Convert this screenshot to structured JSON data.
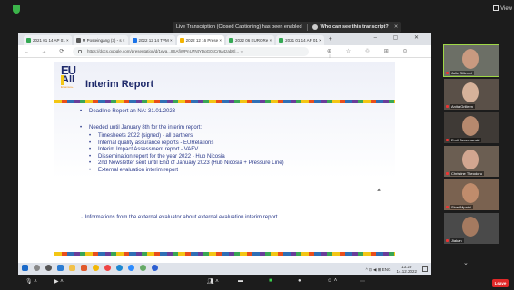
{
  "zoom": {
    "view_label": "View",
    "notice_text": "Live Transcription (Closed Captioning) has been enabled",
    "notice_question": "Who can see this transcript?",
    "leave_label": "Leave"
  },
  "browser": {
    "tabs": [
      {
        "label": "2021 01 14 AP 01 ×",
        "color": "#34a853"
      },
      {
        "label": "M Posteingang (3) - s ×",
        "color": "#555555"
      },
      {
        "label": "2022 12 14 TPM ×",
        "color": "#1a73e8"
      },
      {
        "label": "2022 12 16 Prese ×",
        "color": "#f4b400",
        "active": true
      },
      {
        "label": "2022 06 EURORe ×",
        "color": "#34a853"
      },
      {
        "label": "2021 01 14 AP 01 ×",
        "color": "#34a853"
      }
    ],
    "url": "https://docs.google.com/presentation/d/1eva...8SAfiWPnU7NtYDgG0xCr9a4zabXl... ☆"
  },
  "slide": {
    "logo_eu": "EU",
    "logo_all": "All",
    "logo_sub": "Erasmus+",
    "title": "Interim Report",
    "bullet_deadline": "Deadline Report an NA: 31.01.2023",
    "bullet_needed": "Needed until January 8th for the interim report:",
    "sub_items": [
      "Timesheets 2022 (signed) - all partners",
      "Internal quality assurance reports - EURelations",
      "Interim Impact Assessment report - VAEV",
      "Dissemination report for the year 2022 - Hub Nicosia",
      "2nd Newsletter sent until End of January 2023 (Hub Nicosia + Pressure Line)",
      "External evaluation interim report"
    ],
    "arrow_note": "→ Informations from the external evaluator about external evaluation interim report"
  },
  "taskbar": {
    "time": "13:29",
    "date": "14.12.2022",
    "tray_text": "^ ⊡ ◀ ⊞ ENG"
  },
  "participants": [
    {
      "name": "Julie Sillerud",
      "skin": "#c99a80",
      "bg": "#6c6f66",
      "speaking": true
    },
    {
      "name": "Anita Grilleen",
      "skin": "#d6b29a",
      "bg": "#5a5048"
    },
    {
      "name": "Emil Szczepanski",
      "skin": "#b6896e",
      "bg": "#3f3a36"
    },
    {
      "name": "Christine Theodoru",
      "skin": "#d2a690",
      "bg": "#6b5e52"
    },
    {
      "name": "Sinei Mpaini",
      "skin": "#c08c6c",
      "bg": "#7a6250"
    },
    {
      "name": "Jiakan",
      "skin": "#a57a60",
      "bg": "#4a4a4a"
    }
  ]
}
